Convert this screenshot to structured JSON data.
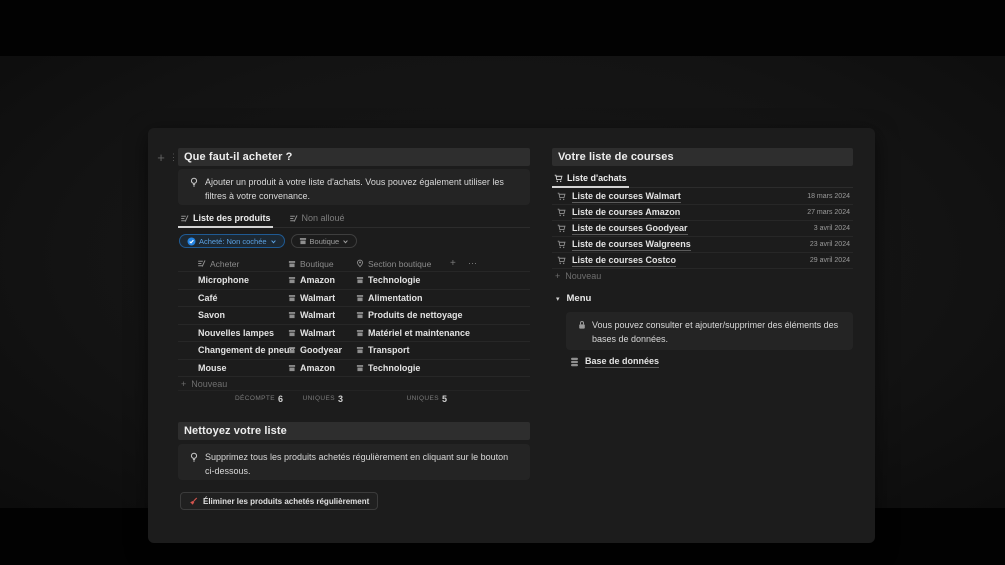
{
  "colors": {
    "accent_blue": "#2383e2",
    "danger_red": "#d4544e"
  },
  "icons": {
    "plus": "+",
    "drag": "⋮⋮",
    "dots": "⋯",
    "triangle": "▾"
  },
  "left": {
    "title": "Que faut-il acheter ?",
    "tip": "Ajouter un produit à votre liste d'achats. Vous pouvez également utiliser les filtres à votre convenance.",
    "tabs": {
      "products": "Liste des produits",
      "unassigned": "Non alloué"
    },
    "filters": {
      "purchased": "Acheté: Non cochée",
      "shop": "Boutique"
    },
    "table": {
      "headers": {
        "buy": "Acheter",
        "shop": "Boutique",
        "section": "Section boutique"
      },
      "rows": [
        {
          "name": "Microphone",
          "shop": "Amazon",
          "section": "Technologie"
        },
        {
          "name": "Café",
          "shop": "Walmart",
          "section": "Alimentation"
        },
        {
          "name": "Savon",
          "shop": "Walmart",
          "section": "Produits de nettoyage"
        },
        {
          "name": "Nouvelles lampes",
          "shop": "Walmart",
          "section": "Matériel et maintenance"
        },
        {
          "name": "Changement de pneus",
          "shop": "Goodyear",
          "section": "Transport"
        },
        {
          "name": "Mouse",
          "shop": "Amazon",
          "section": "Technologie"
        }
      ],
      "new_label": "Nouveau",
      "footer": {
        "count_label": "DÉCOMPTE",
        "count_value": "6",
        "unique1_label": "UNIQUES",
        "unique1_value": "3",
        "unique2_label": "UNIQUES",
        "unique2_value": "5"
      }
    },
    "clean": {
      "title": "Nettoyez votre liste",
      "tip": "Supprimez tous les produits achetés régulièrement en cliquant sur le bouton ci-dessous.",
      "button_label": "Éliminer les produits achetés régulièrement"
    }
  },
  "right": {
    "title": "Votre liste de courses",
    "tab": "Liste d'achats",
    "lists": [
      {
        "name": "Liste de courses Walmart",
        "date": "18 mars 2024"
      },
      {
        "name": "Liste de courses Amazon",
        "date": "27 mars 2024"
      },
      {
        "name": "Liste de courses Goodyear",
        "date": "3 avril 2024"
      },
      {
        "name": "Liste de courses Walgreens",
        "date": "23 avril 2024"
      },
      {
        "name": "Liste de courses Costco",
        "date": "29 avril 2024"
      }
    ],
    "new_label": "Nouveau",
    "menu": {
      "label": "Menu",
      "tip": "Vous pouvez consulter et ajouter/supprimer des éléments des bases de données.",
      "db_link": "Base de données"
    }
  }
}
